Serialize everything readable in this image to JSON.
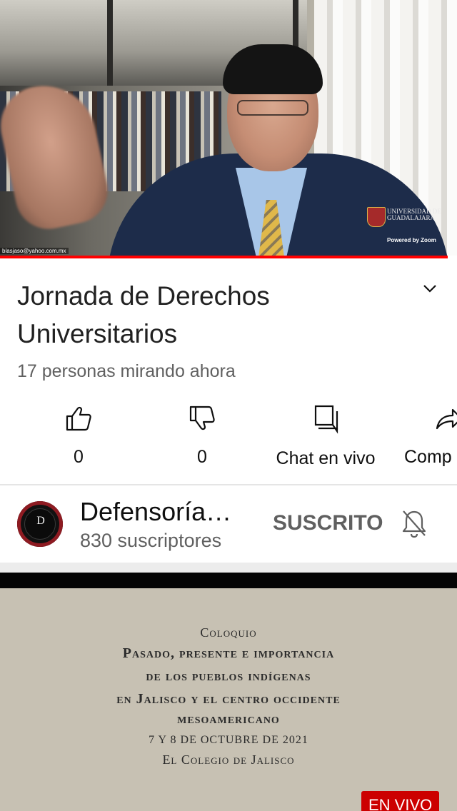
{
  "video": {
    "email_overlay": "blasjaso@yahoo.com.mx",
    "university_watermark": "UNIVERSIDAD DE GUADALAJARA",
    "zoom_credit": "Powered by Zoom",
    "progress_fraction": 0.98
  },
  "title": "Jornada de Derechos Universitarios",
  "viewers": "17 personas mirando ahora",
  "actions": {
    "like": {
      "icon": "thumbs-up-icon",
      "count": "0"
    },
    "dislike": {
      "icon": "thumbs-down-icon",
      "count": "0"
    },
    "chat": {
      "icon": "chat-icon",
      "label": "Chat en vivo"
    },
    "share": {
      "icon": "share-icon",
      "label": "Comp"
    }
  },
  "channel": {
    "avatar_letter": "D",
    "name": "Defensoría…",
    "subscribers": "830 suscriptores",
    "subscribe_label": "SUSCRITO",
    "notifications": "bell-off-icon"
  },
  "next_video": {
    "kicker": "Coloquio",
    "lines": [
      "Pasado, presente e importancia",
      "de los pueblos indígenas",
      "en Jalisco y el centro occidente",
      "mesoamericano"
    ],
    "date": "7 Y 8 DE OCTUBRE DE 2021",
    "place": "El Colegio de Jalisco",
    "live_badge": "EN VIVO"
  },
  "colors": {
    "accent": "#ff0000",
    "live": "#cc0000",
    "text_secondary": "#606060"
  }
}
